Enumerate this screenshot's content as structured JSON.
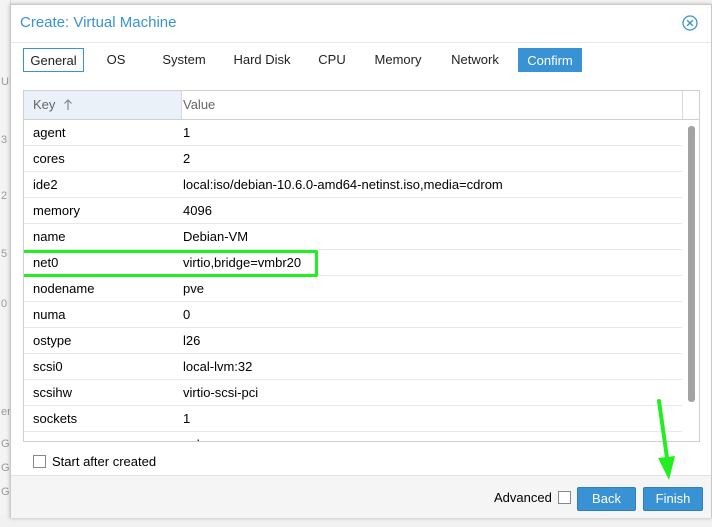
{
  "background": {
    "edge_letters": [
      "U",
      "3",
      "2",
      "5",
      "0",
      "en",
      "G",
      "G",
      "G"
    ]
  },
  "dialog": {
    "title": "Create: Virtual Machine",
    "close_icon": "close-icon",
    "accent_color": "#3892d4"
  },
  "tabs": [
    {
      "label": "General",
      "state": "outlined"
    },
    {
      "label": "OS",
      "state": "normal"
    },
    {
      "label": "System",
      "state": "normal"
    },
    {
      "label": "Hard Disk",
      "state": "normal"
    },
    {
      "label": "CPU",
      "state": "normal"
    },
    {
      "label": "Memory",
      "state": "normal"
    },
    {
      "label": "Network",
      "state": "normal"
    },
    {
      "label": "Confirm",
      "state": "active"
    }
  ],
  "grid": {
    "columns": {
      "key": "Key",
      "value": "Value"
    },
    "sort_icon": "sort-ascending-icon",
    "rows": [
      {
        "key": "agent",
        "value": "1"
      },
      {
        "key": "cores",
        "value": "2"
      },
      {
        "key": "ide2",
        "value": "local:iso/debian-10.6.0-amd64-netinst.iso,media=cdrom"
      },
      {
        "key": "memory",
        "value": "4096"
      },
      {
        "key": "name",
        "value": "Debian-VM"
      },
      {
        "key": "net0",
        "value": "virtio,bridge=vmbr20",
        "highlighted": true
      },
      {
        "key": "nodename",
        "value": "pve"
      },
      {
        "key": "numa",
        "value": "0"
      },
      {
        "key": "ostype",
        "value": "l26"
      },
      {
        "key": "scsi0",
        "value": "local-lvm:32"
      },
      {
        "key": "scsihw",
        "value": "virtio-scsi-pci"
      },
      {
        "key": "sockets",
        "value": "1"
      },
      {
        "key": "vga",
        "value": "qxl"
      }
    ],
    "highlight_color": "#22ee22"
  },
  "start_after_created": {
    "label": "Start after created",
    "checked": false
  },
  "footer": {
    "advanced_label": "Advanced",
    "advanced_checked": false,
    "back_label": "Back",
    "finish_label": "Finish"
  },
  "annotation": {
    "arrow_color": "#22ee22",
    "arrow_target": "finish-button"
  }
}
